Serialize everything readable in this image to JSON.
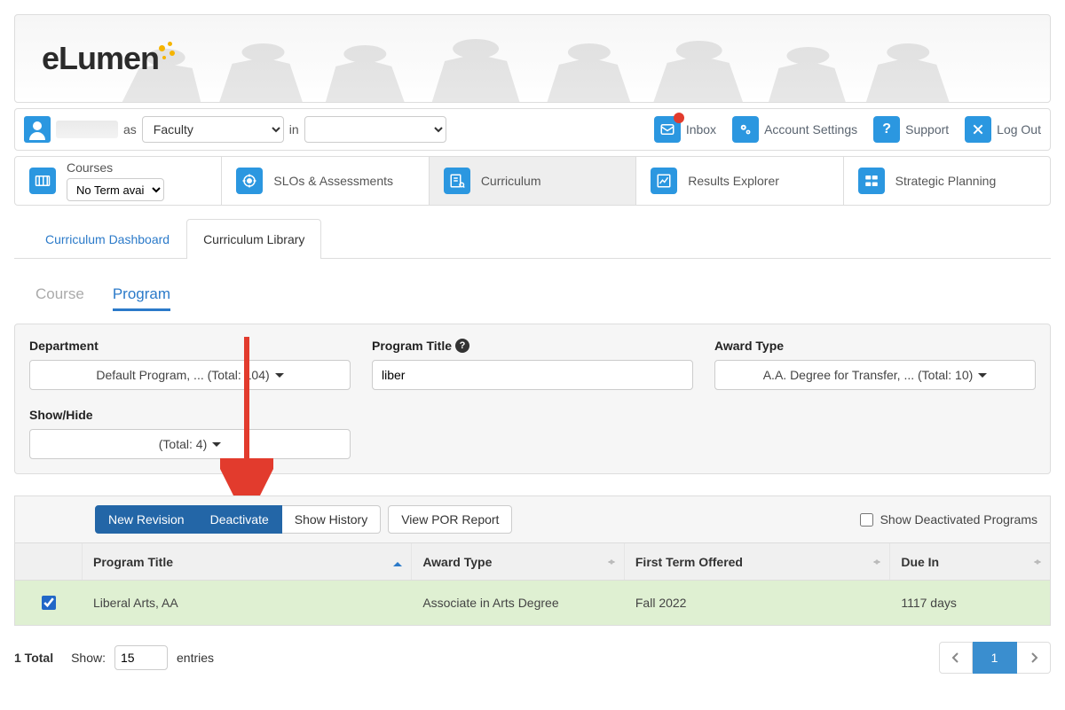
{
  "brand": "eLumen",
  "user_bar": {
    "as_label": "as",
    "in_label": "in",
    "role_selected": "Faculty",
    "dept_selected": "",
    "inbox": "Inbox",
    "account_settings": "Account Settings",
    "support": "Support",
    "logout": "Log Out"
  },
  "main_nav": {
    "courses": {
      "label": "Courses",
      "term_selected": "No Term avai..."
    },
    "slos": "SLOs & Assessments",
    "curriculum": "Curriculum",
    "results_explorer": "Results Explorer",
    "strategic_planning": "Strategic Planning"
  },
  "subtabs": {
    "dashboard": "Curriculum Dashboard",
    "library": "Curriculum Library"
  },
  "mini_tabs": {
    "course": "Course",
    "program": "Program"
  },
  "filters": {
    "department": {
      "label": "Department",
      "value": "Default Program, ... (Total: 104)"
    },
    "program_title": {
      "label": "Program Title",
      "value": "liber"
    },
    "award_type": {
      "label": "Award Type",
      "value": "A.A. Degree for Transfer, ... (Total: 10)"
    },
    "show_hide": {
      "label": "Show/Hide",
      "value": "(Total: 4)"
    }
  },
  "toolbar": {
    "new_revision": "New Revision",
    "deactivate": "Deactivate",
    "show_history": "Show History",
    "view_por": "View POR Report",
    "show_deactivated": "Show Deactivated Programs"
  },
  "columns": {
    "program_title": "Program Title",
    "award_type": "Award Type",
    "first_term": "First Term Offered",
    "due_in": "Due In"
  },
  "rows": [
    {
      "checked": true,
      "program_title": "Liberal Arts, AA",
      "award_type": "Associate in Arts Degree",
      "first_term": "Fall 2022",
      "due_in": "1117 days"
    }
  ],
  "footer": {
    "total_label": "1 Total",
    "show_label": "Show:",
    "entries_value": "15",
    "entries_suffix": "entries",
    "page_current": "1"
  }
}
